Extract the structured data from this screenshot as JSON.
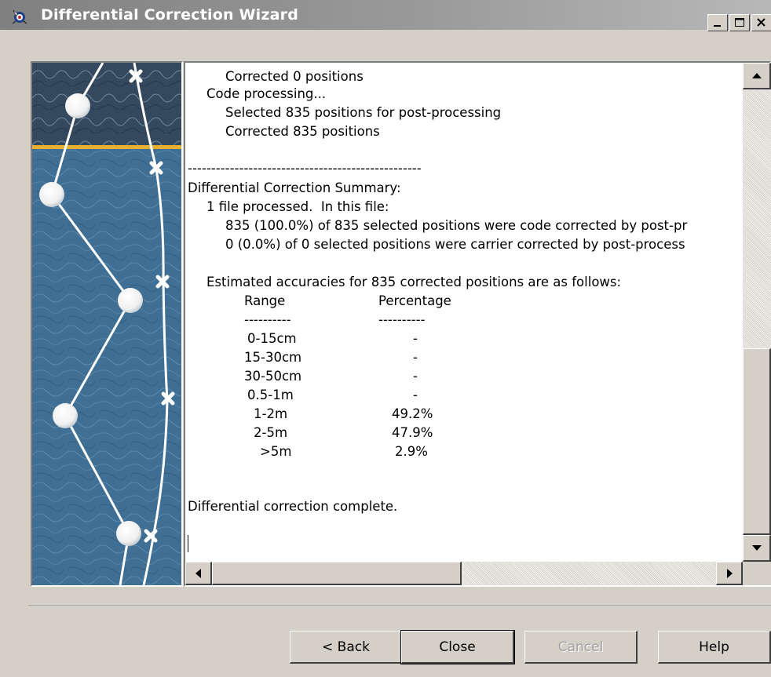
{
  "window": {
    "title": "Differential Correction Wizard",
    "icon": "wizard-satellite-icon",
    "controls": [
      "minimize-icon",
      "maximize-icon",
      "close-icon"
    ]
  },
  "log": {
    "lines": [
      "Corrected 0 positions",
      "Code processing...",
      "Selected 835 positions for post-processing",
      "Corrected 835 positions",
      "--------------------------------------------------",
      "Differential Correction Summary:",
      "1 file processed.  In this file:",
      "835 (100.0%) of 835 selected positions were code corrected by post-pr",
      "0 (0.0%) of 0 selected positions were carrier corrected by post-process",
      "Estimated accuracies for 835 corrected positions are as follows:",
      "Differential correction complete."
    ],
    "accuracy_table": {
      "headers": [
        "Range",
        "Percentage"
      ],
      "divider": [
        "----------",
        "----------"
      ],
      "rows": [
        {
          "range": "0-15cm",
          "percentage": "-"
        },
        {
          "range": "15-30cm",
          "percentage": "-"
        },
        {
          "range": "30-50cm",
          "percentage": "-"
        },
        {
          "range": "0.5-1m",
          "percentage": "-"
        },
        {
          "range": "1-2m",
          "percentage": "49.2%"
        },
        {
          "range": "2-5m",
          "percentage": "47.9%"
        },
        {
          "range": ">5m",
          "percentage": "2.9%"
        }
      ]
    }
  },
  "buttons": {
    "back": "< Back",
    "close": "Close",
    "cancel": "Cancel",
    "help": "Help"
  },
  "colors": {
    "dialog_face": "#d4d0c8",
    "titlebar_inactive": "#808080",
    "map_blue": "#3f6f94",
    "banner_gold": "#e8b030"
  }
}
